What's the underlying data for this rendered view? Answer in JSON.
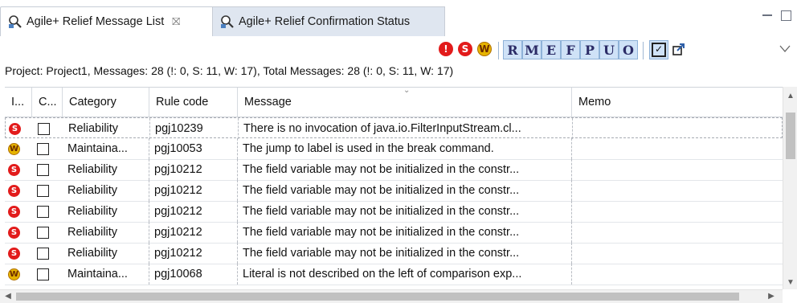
{
  "tabs": [
    {
      "label": "Agile+ Relief Message List",
      "active": true,
      "close": "⛝"
    },
    {
      "label": "Agile+ Relief Confirmation Status",
      "active": false
    }
  ],
  "toolbar": {
    "filters": [
      {
        "icon": "error-filter-icon",
        "glyph": "!"
      },
      {
        "icon": "serious-filter-icon",
        "glyph": "S"
      },
      {
        "icon": "warning-filter-icon",
        "glyph": "W"
      }
    ],
    "letters": [
      "R",
      "M",
      "E",
      "F",
      "P",
      "U",
      "O"
    ],
    "check_glyph": "✓"
  },
  "summary": "Project: Project1,  Messages: 28 (!: 0, S: 11, W: 17),  Total Messages: 28 (!: 0, S: 11, W: 17)",
  "columns": [
    "I...",
    "C...",
    "Category",
    "Rule code",
    "Message",
    "Memo"
  ],
  "rows": [
    {
      "level": "S",
      "category": "Reliability",
      "rule": "pgj10239",
      "message": "There is no invocation of java.io.FilterInputStream.cl...",
      "memo": ""
    },
    {
      "level": "W",
      "category": "Maintaina...",
      "rule": "pgj10053",
      "message": "The jump to label is used in the break command.",
      "memo": ""
    },
    {
      "level": "S",
      "category": "Reliability",
      "rule": "pgj10212",
      "message": "The field variable may not be initialized in the constr...",
      "memo": ""
    },
    {
      "level": "S",
      "category": "Reliability",
      "rule": "pgj10212",
      "message": "The field variable may not be initialized in the constr...",
      "memo": ""
    },
    {
      "level": "S",
      "category": "Reliability",
      "rule": "pgj10212",
      "message": "The field variable may not be initialized in the constr...",
      "memo": ""
    },
    {
      "level": "S",
      "category": "Reliability",
      "rule": "pgj10212",
      "message": "The field variable may not be initialized in the constr...",
      "memo": ""
    },
    {
      "level": "S",
      "category": "Reliability",
      "rule": "pgj10212",
      "message": "The field variable may not be initialized in the constr...",
      "memo": ""
    },
    {
      "level": "W",
      "category": "Maintaina...",
      "rule": "pgj10068",
      "message": "Literal is not described on the left of comparison exp...",
      "memo": ""
    }
  ],
  "colors": {
    "serious": "#e21b1b",
    "warning": "#e6b400",
    "selected": "#cfe2f7"
  }
}
